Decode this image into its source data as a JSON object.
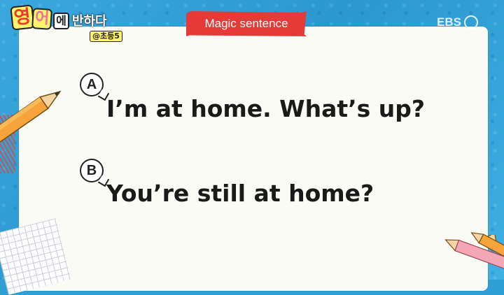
{
  "logo": {
    "part1": "영",
    "part2": "어",
    "part3": "에",
    "part4": "반하다",
    "subtitle": "@초등5"
  },
  "tag": {
    "label": "Magic sentence"
  },
  "watermark": {
    "text": "EBS"
  },
  "dialogue": [
    {
      "speaker": "A",
      "line": "I’m at home. What’s up?"
    },
    {
      "speaker": "B",
      "line": "You’re still at home?"
    }
  ],
  "colors": {
    "background": "#2fa0d6",
    "board": "#fbfbf6",
    "tag": "#e53b36",
    "logo_yellow": "#fff36a"
  },
  "icons": [
    "pencil-icon",
    "graph-paper-decoration",
    "ebs-logo-icon"
  ]
}
